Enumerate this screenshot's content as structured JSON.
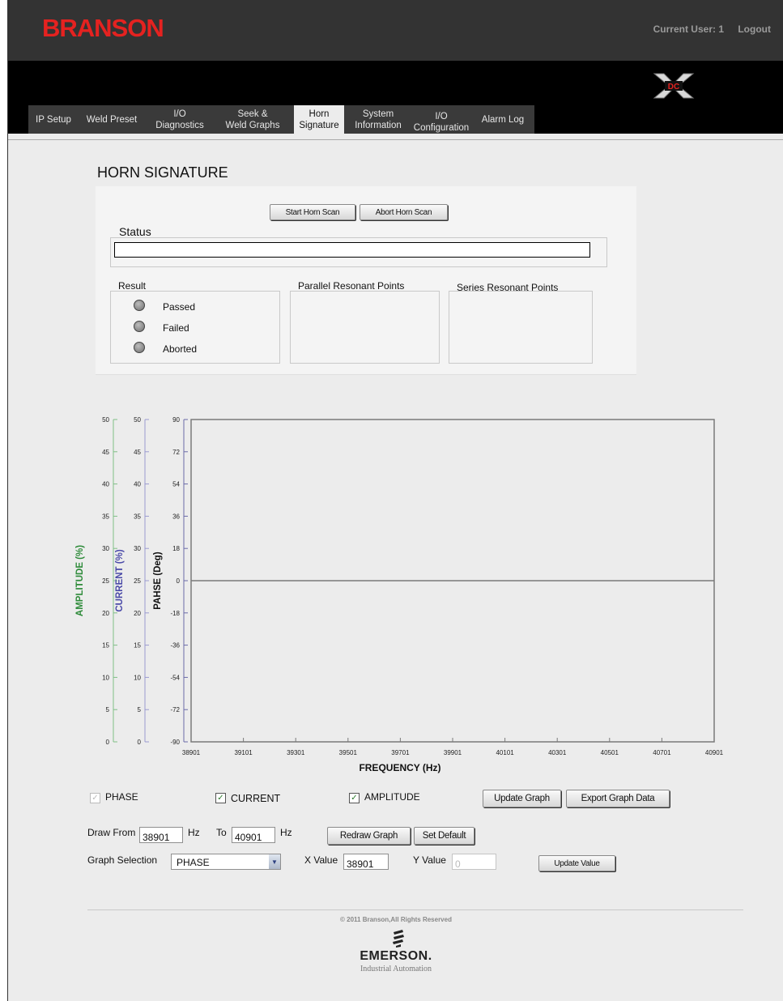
{
  "header": {
    "brand": "BRANSON",
    "current_user": "Current User: 1",
    "logout": "Logout"
  },
  "tabs": [
    {
      "label": "IP Setup"
    },
    {
      "label": "Weld Preset"
    },
    {
      "label": "I/O\nDiagnostics"
    },
    {
      "label": "Seek &\nWeld Graphs"
    },
    {
      "label": "Horn\nSignature"
    },
    {
      "label": "System\nInformation"
    },
    {
      "label": "I/O\nConfiguration"
    },
    {
      "label": "Alarm Log"
    }
  ],
  "page": {
    "title": "HORN SIGNATURE",
    "start_scan": "Start Horn Scan",
    "abort_scan": "Abort Horn Scan",
    "status_label": "Status",
    "status_value": "",
    "result_label": "Result",
    "results": [
      {
        "label": "Passed"
      },
      {
        "label": "Failed"
      },
      {
        "label": "Aborted"
      }
    ],
    "parallel_label": "Parallel  Resonant Points",
    "series_label": "Series Resonant Points"
  },
  "chart_data": {
    "type": "line",
    "xlabel": "FREQUENCY (Hz)",
    "x_ticks": [
      38901,
      39101,
      39301,
      39501,
      39701,
      39901,
      40101,
      40301,
      40501,
      40701,
      40901
    ],
    "xlim": [
      38901,
      40901
    ],
    "y_axes": [
      {
        "label": "AMPLITUDE (%)",
        "color": "#2e8b3a",
        "ticks": [
          0,
          5,
          10,
          15,
          20,
          25,
          30,
          35,
          40,
          45,
          50
        ],
        "ylim": [
          0,
          50
        ]
      },
      {
        "label": "CURRENT (%)",
        "color": "#4a4aa8",
        "ticks": [
          0,
          5,
          10,
          15,
          20,
          25,
          30,
          35,
          40,
          45,
          50
        ],
        "ylim": [
          0,
          50
        ]
      },
      {
        "label": "PAHSE (Deg)",
        "color": "#111111",
        "ticks": [
          -90,
          -72,
          -54,
          -36,
          -18,
          0,
          18,
          36,
          54,
          72,
          90
        ],
        "ylim": [
          -90,
          90
        ]
      }
    ],
    "series": [
      {
        "name": "PHASE",
        "values": [
          0,
          0,
          0,
          0,
          0,
          0,
          0,
          0,
          0,
          0,
          0
        ]
      }
    ],
    "grid": false
  },
  "controls": {
    "phase": "PHASE",
    "phase_checked": "✓",
    "current": "CURRENT",
    "current_checked": "✓",
    "amplitude": "AMPLITUDE",
    "amplitude_checked": "✓",
    "update_graph": "Update Graph",
    "export_graph": "Export Graph Data",
    "draw_from_label": "Draw From",
    "draw_from_value": "38901",
    "hz1": "Hz",
    "to_label": "To",
    "to_value": "40901",
    "hz2": "Hz",
    "redraw": "Redraw Graph",
    "set_default": "Set Default",
    "graph_selection_label": "Graph Selection",
    "graph_selection_value": "PHASE",
    "x_value_label": "X Value",
    "x_value": "38901",
    "y_value_label": "Y Value",
    "y_value": "0",
    "update_value": "Update Value"
  },
  "footer": {
    "copyright": "© 2011 Branson,All Rights Reserved",
    "emerson": "EMERSON.",
    "emerson_sub": "Industrial Automation"
  }
}
